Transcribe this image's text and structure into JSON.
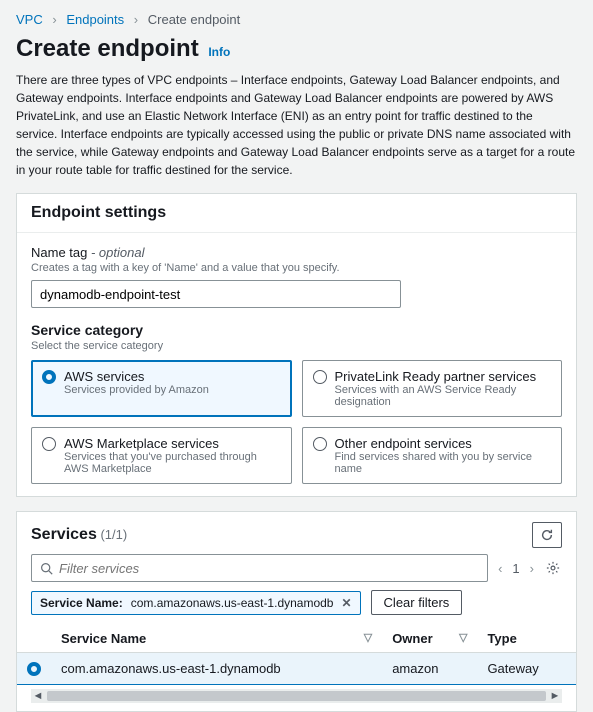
{
  "breadcrumb": {
    "vpc": "VPC",
    "endpoints": "Endpoints",
    "current": "Create endpoint"
  },
  "page": {
    "title": "Create endpoint",
    "info": "Info",
    "intro": "There are three types of VPC endpoints – Interface endpoints, Gateway Load Balancer endpoints, and Gateway endpoints. Interface endpoints and Gateway Load Balancer endpoints are powered by AWS PrivateLink, and use an Elastic Network Interface (ENI) as an entry point for traffic destined to the service. Interface endpoints are typically accessed using the public or private DNS name associated with the service, while Gateway endpoints and Gateway Load Balancer endpoints serve as a target for a route in your route table for traffic destined for the service."
  },
  "settings": {
    "panel_title": "Endpoint settings",
    "name_label": "Name tag",
    "name_optional": " - optional",
    "name_hint": "Creates a tag with a key of 'Name' and a value that you specify.",
    "name_value": "dynamodb-endpoint-test",
    "category_title": "Service category",
    "category_hint": "Select the service category",
    "options": [
      {
        "title": "AWS services",
        "sub": "Services provided by Amazon",
        "selected": true
      },
      {
        "title": "PrivateLink Ready partner services",
        "sub": "Services with an AWS Service Ready designation",
        "selected": false
      },
      {
        "title": "AWS Marketplace services",
        "sub": "Services that you've purchased through AWS Marketplace",
        "selected": false
      },
      {
        "title": "Other endpoint services",
        "sub": "Find services shared with you by service name",
        "selected": false
      }
    ]
  },
  "services": {
    "title": "Services",
    "count": "(1/1)",
    "search_placeholder": "Filter services",
    "page_current": "1",
    "filter_label": "Service Name:",
    "filter_value": "com.amazonaws.us-east-1.dynamodb",
    "clear": "Clear filters",
    "columns": {
      "c0": "",
      "c1": "Service Name",
      "c2": "Owner",
      "c3": "Type"
    },
    "rows": [
      {
        "name": "com.amazonaws.us-east-1.dynamodb",
        "owner": "amazon",
        "type": "Gateway",
        "selected": true
      }
    ]
  }
}
